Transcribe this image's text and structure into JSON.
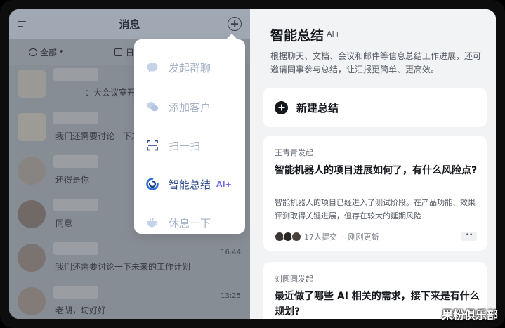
{
  "left_panel": {
    "header_title": "消息",
    "filter_all": "全部",
    "filter_date": "日",
    "messages": [
      {
        "preview": "：大会议室开展",
        "time": ""
      },
      {
        "preview": "我们还需要讨论一下未",
        "time": ""
      },
      {
        "preview": "还得是你",
        "time": ""
      },
      {
        "preview": "同意",
        "time": ""
      },
      {
        "preview": "我们还需要讨论一下未来的工作计划",
        "time": "16:44"
      },
      {
        "preview": "老胡，切好好",
        "time": "13:25"
      }
    ]
  },
  "popup_menu": {
    "items": [
      {
        "label": "发起群聊",
        "icon": "chat-bubble-icon"
      },
      {
        "label": "添加客户",
        "icon": "wechat-icon"
      },
      {
        "label": "扫一扫",
        "icon": "scan-icon"
      },
      {
        "label": "智能总结",
        "icon": "ai-summary-icon",
        "tag": "AI+"
      },
      {
        "label": "休息一下",
        "icon": "coffee-cup-icon"
      }
    ]
  },
  "right_panel": {
    "title": "智能总结",
    "ai_tag": "AI+",
    "description": "根据聊天、文档、会议和邮件等信息总结工作进展，还可邀请同事参与总结，让汇报更简单、更高效。",
    "new_summary_label": "新建总结",
    "cards": [
      {
        "author": "王青青发起",
        "title": "智能机器人的项目进展如何了，有什么风险点?",
        "body": "智能机器人的项目已经进入了测试阶段。在产品功能、效果评测取得关键进展，但存在较大的延期风险",
        "submitters": "17人提交",
        "separator": "·",
        "updated": "刚刚更新",
        "more": "••"
      },
      {
        "author": "刘圆圆发起",
        "title": "最近做了哪些 AI 相关的需求，接下来是有什么规划?"
      }
    ]
  },
  "watermark": "果粉俱乐部",
  "colors": {
    "accent_blue": "#2c4a8e",
    "menu_text_muted": "#a6b3c7",
    "ai_purple": "#6f6de9"
  }
}
